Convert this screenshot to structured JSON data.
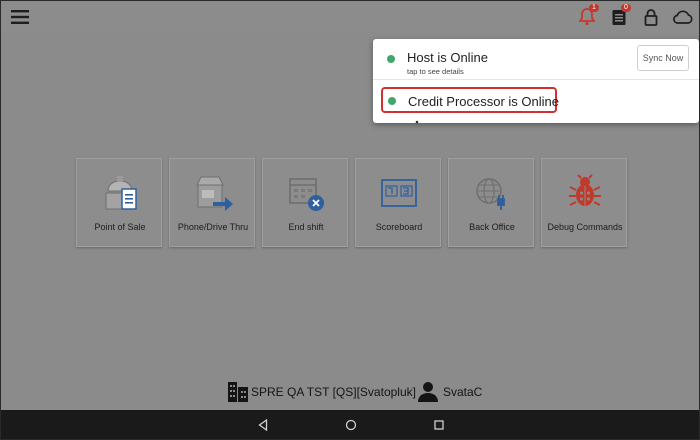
{
  "topbar": {
    "icons": [
      "menu-icon",
      "bell-icon",
      "document-icon",
      "lock-icon",
      "cloud-icon"
    ],
    "bell_badge": "1",
    "doc_badge": "0"
  },
  "status_popover": {
    "host_title": "Host is Online",
    "host_subtitle": "tap to see details",
    "sync_button_label": "Sync Now",
    "credit_title": "Credit Processor is Online",
    "online_color": "#3fa86b",
    "highlight_color": "#d32f2f"
  },
  "tiles": [
    {
      "label": "Point of Sale",
      "icon": "pos-icon"
    },
    {
      "label": "Phone/Drive Thru",
      "icon": "phone-drive-thru-icon"
    },
    {
      "label": "End shift",
      "icon": "end-shift-icon"
    },
    {
      "label": "Scoreboard",
      "icon": "scoreboard-icon"
    },
    {
      "label": "Back Office",
      "icon": "back-office-icon"
    },
    {
      "label": "Debug Commands",
      "icon": "bug-icon"
    }
  ],
  "footer": {
    "store_label": "SPRE QA TST [QS][Svatopluk]",
    "user_label": "SvataC"
  },
  "colors": {
    "accent_blue": "#2f5f9e",
    "bug_red": "#c0392b",
    "badge_red": "#c23a2d"
  }
}
